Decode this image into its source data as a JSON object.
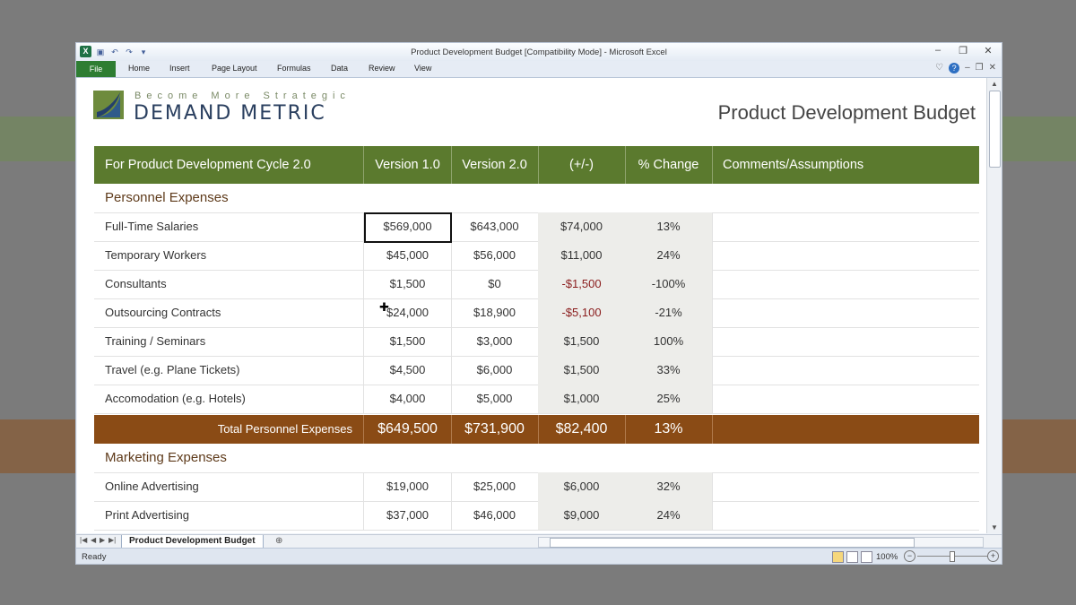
{
  "window": {
    "title": "Product Development Budget  [Compatibility Mode]  -  Microsoft Excel",
    "app_icon": "X"
  },
  "ribbon": {
    "file_tab": "File",
    "tabs": [
      "Home",
      "Insert",
      "Page Layout",
      "Formulas",
      "Data",
      "Review",
      "View"
    ]
  },
  "sheet": {
    "logo_tagline": "Become More Strategic",
    "logo_name": "DEMAND METRIC",
    "title": "Product Development Budget",
    "header": {
      "label": "For Product Development Cycle 2.0",
      "v1": "Version 1.0",
      "v2": "Version 2.0",
      "diff": "(+/-)",
      "pct": "% Change",
      "comments": "Comments/Assumptions"
    },
    "personnel_section": "Personnel Expenses",
    "personnel_rows": [
      {
        "label": "Full-Time Salaries",
        "v1": "$569,000",
        "v2": "$643,000",
        "diff": "$74,000",
        "pct": "13%"
      },
      {
        "label": "Temporary Workers",
        "v1": "$45,000",
        "v2": "$56,000",
        "diff": "$11,000",
        "pct": "24%"
      },
      {
        "label": "Consultants",
        "v1": "$1,500",
        "v2": "$0",
        "diff": "-$1,500",
        "pct": "-100%"
      },
      {
        "label": "Outsourcing Contracts",
        "v1": "$24,000",
        "v2": "$18,900",
        "diff": "-$5,100",
        "pct": "-21%"
      },
      {
        "label": "Training / Seminars",
        "v1": "$1,500",
        "v2": "$3,000",
        "diff": "$1,500",
        "pct": "100%"
      },
      {
        "label": "Travel (e.g. Plane Tickets)",
        "v1": "$4,500",
        "v2": "$6,000",
        "diff": "$1,500",
        "pct": "33%"
      },
      {
        "label": "Accomodation (e.g. Hotels)",
        "v1": "$4,000",
        "v2": "$5,000",
        "diff": "$1,000",
        "pct": "25%"
      }
    ],
    "personnel_total": {
      "label": "Total Personnel Expenses",
      "v1": "$649,500",
      "v2": "$731,900",
      "diff": "$82,400",
      "pct": "13%"
    },
    "marketing_section": "Marketing Expenses",
    "marketing_rows": [
      {
        "label": "Online Advertising",
        "v1": "$19,000",
        "v2": "$25,000",
        "diff": "$6,000",
        "pct": "32%"
      },
      {
        "label": "Print Advertising",
        "v1": "$37,000",
        "v2": "$46,000",
        "diff": "$9,000",
        "pct": "24%"
      }
    ]
  },
  "sheet_tab": "Product Development Budget",
  "status": {
    "ready": "Ready",
    "zoom": "100%"
  },
  "colors": {
    "header_green": "#5b7a2e",
    "total_brown": "#8a4b15",
    "negative_red": "#8a1c1c"
  }
}
